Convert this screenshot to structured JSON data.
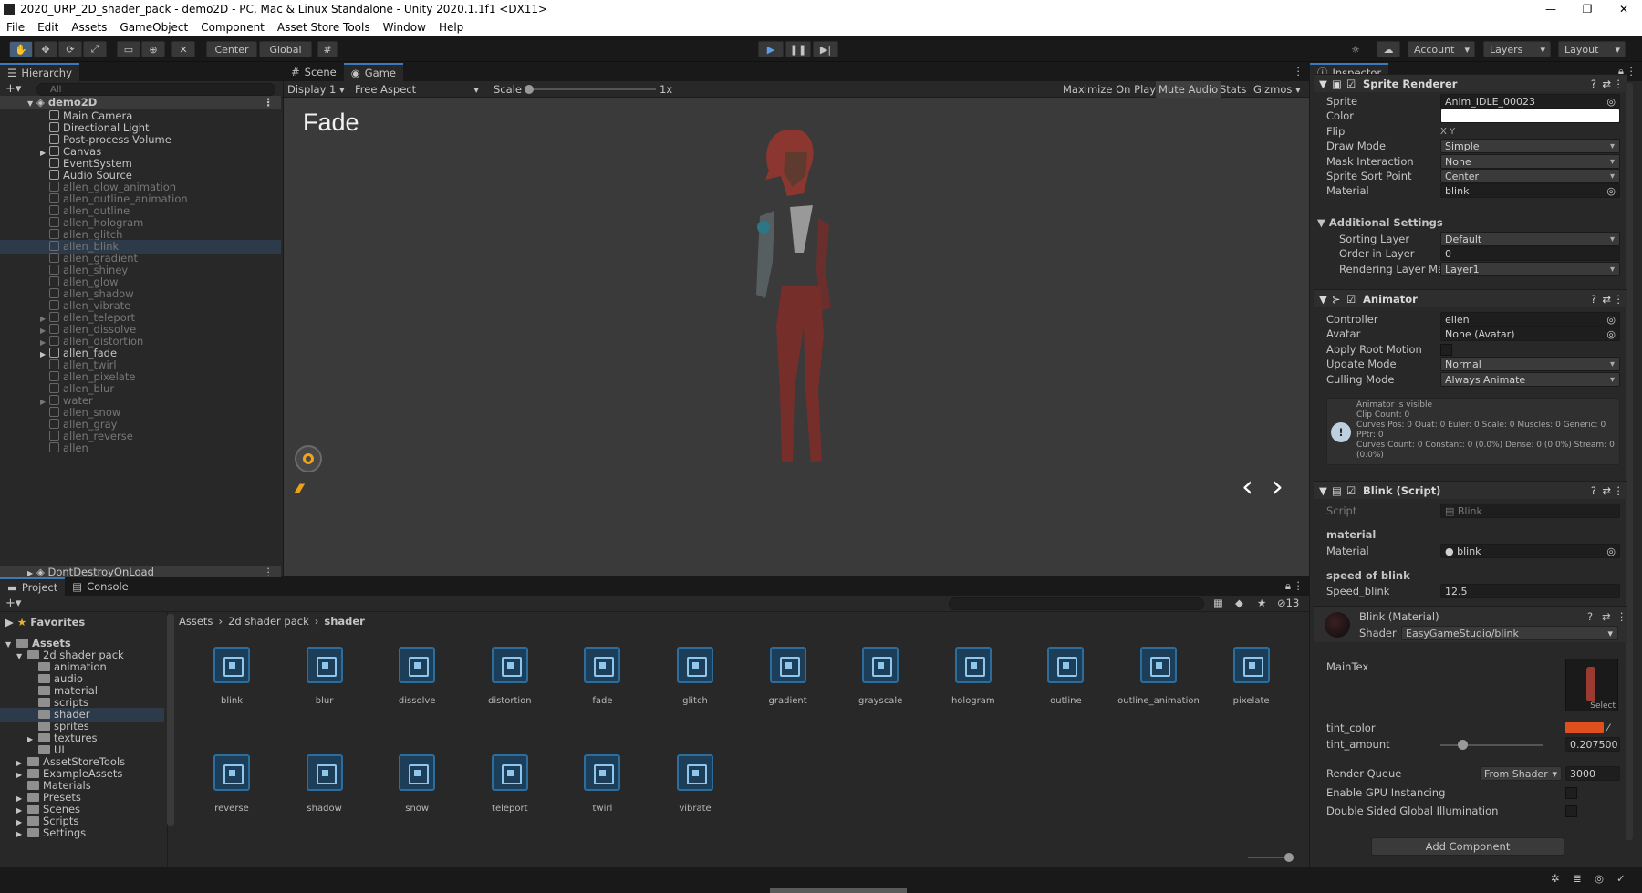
{
  "window": {
    "title": "2020_URP_2D_shader_pack - demo2D - PC, Mac & Linux Standalone - Unity 2020.1.1f1 <DX11>",
    "minimize": "—",
    "maximize": "❐",
    "close": "✕"
  },
  "menu": [
    "File",
    "Edit",
    "Assets",
    "GameObject",
    "Component",
    "Asset Store Tools",
    "Window",
    "Help"
  ],
  "toolbar": {
    "pivot": "Center",
    "space": "Global",
    "account": "Account",
    "layers": "Layers",
    "layout": "Layout"
  },
  "hierarchy": {
    "tab": "Hierarchy",
    "search_placeholder": "All",
    "scene": "demo2D",
    "items": [
      {
        "label": "Main Camera",
        "dim": false,
        "arrow": false
      },
      {
        "label": "Directional Light",
        "dim": false,
        "arrow": false
      },
      {
        "label": "Post-process Volume",
        "dim": false,
        "arrow": false
      },
      {
        "label": "Canvas",
        "dim": false,
        "arrow": true
      },
      {
        "label": "EventSystem",
        "dim": false,
        "arrow": false
      },
      {
        "label": "Audio Source",
        "dim": false,
        "arrow": false
      },
      {
        "label": "allen_glow_animation",
        "dim": true,
        "arrow": false
      },
      {
        "label": "allen_outline_animation",
        "dim": true,
        "arrow": false
      },
      {
        "label": "allen_outline",
        "dim": true,
        "arrow": false
      },
      {
        "label": "allen_hologram",
        "dim": true,
        "arrow": false
      },
      {
        "label": "allen_glitch",
        "dim": true,
        "arrow": false
      },
      {
        "label": "allen_blink",
        "dim": true,
        "arrow": false
      },
      {
        "label": "allen_gradient",
        "dim": true,
        "arrow": false
      },
      {
        "label": "allen_shiney",
        "dim": true,
        "arrow": false
      },
      {
        "label": "allen_glow",
        "dim": true,
        "arrow": false
      },
      {
        "label": "allen_shadow",
        "dim": true,
        "arrow": false
      },
      {
        "label": "allen_vibrate",
        "dim": true,
        "arrow": false
      },
      {
        "label": "allen_teleport",
        "dim": true,
        "arrow": true
      },
      {
        "label": "allen_dissolve",
        "dim": true,
        "arrow": true
      },
      {
        "label": "allen_distortion",
        "dim": true,
        "arrow": true
      },
      {
        "label": "allen_fade",
        "dim": false,
        "arrow": true
      },
      {
        "label": "allen_twirl",
        "dim": true,
        "arrow": false
      },
      {
        "label": "allen_pixelate",
        "dim": true,
        "arrow": false
      },
      {
        "label": "allen_blur",
        "dim": true,
        "arrow": false
      },
      {
        "label": "water",
        "dim": true,
        "arrow": true
      },
      {
        "label": "allen_snow",
        "dim": true,
        "arrow": false
      },
      {
        "label": "allen_gray",
        "dim": true,
        "arrow": false
      },
      {
        "label": "allen_reverse",
        "dim": true,
        "arrow": false
      },
      {
        "label": "allen",
        "dim": true,
        "arrow": false
      }
    ],
    "dontdestroy": "DontDestroyOnLoad"
  },
  "game": {
    "tab_scene": "Scene",
    "tab_game": "Game",
    "display": "Display 1",
    "aspect": "Free Aspect",
    "scale_label": "Scale",
    "scale_value": "1x",
    "maximize": "Maximize On Play",
    "mute": "Mute Audio",
    "stats": "Stats",
    "gizmos": "Gizmos",
    "overlay_title": "Fade",
    "prev": "‹",
    "next": "›"
  },
  "inspector": {
    "tab": "Inspector",
    "sprite_renderer": {
      "title": "Sprite Renderer",
      "rows": [
        {
          "label": "Sprite",
          "value": "Anim_IDLE_00023"
        },
        {
          "label": "Color",
          "value": ""
        },
        {
          "label": "Flip",
          "value": "X      Y"
        },
        {
          "label": "Draw Mode",
          "value": "Simple"
        },
        {
          "label": "Mask Interaction",
          "value": "None"
        },
        {
          "label": "Sprite Sort Point",
          "value": "Center"
        },
        {
          "label": "Material",
          "value": "blink"
        }
      ],
      "additional": "Additional Settings",
      "sub_rows": [
        {
          "label": "Sorting Layer",
          "value": "Default"
        },
        {
          "label": "Order in Layer",
          "value": "0"
        },
        {
          "label": "Rendering Layer Mas",
          "value": "Layer1"
        }
      ]
    },
    "animator": {
      "title": "Animator",
      "rows": [
        {
          "label": "Controller",
          "value": "ellen"
        },
        {
          "label": "Avatar",
          "value": "None (Avatar)"
        },
        {
          "label": "Apply Root Motion",
          "value": ""
        },
        {
          "label": "Update Mode",
          "value": "Normal"
        },
        {
          "label": "Culling Mode",
          "value": "Always Animate"
        }
      ],
      "info": [
        "Animator is visible",
        "Clip Count: 0",
        "Curves Pos: 0 Quat: 0 Euler: 0 Scale: 0 Muscles: 0 Generic: 0",
        "PPtr: 0",
        "Curves Count: 0 Constant: 0 (0.0%) Dense: 0 (0.0%) Stream: 0",
        "(0.0%)"
      ]
    },
    "blink_script": {
      "title": "Blink (Script)",
      "script_label": "Script",
      "script_value": "Blink",
      "header_material": "material",
      "material_label": "Material",
      "material_value": "blink",
      "header_speed": "speed of blink",
      "speed_label": "Speed_blink",
      "speed_value": "12.5"
    },
    "material": {
      "title": "Blink (Material)",
      "shader_label": "Shader",
      "shader_value": "EasyGameStudio/blink",
      "maintex": "MainTex",
      "select": "Select",
      "tint_color": "tint_color",
      "tint_amount": "tint_amount",
      "tint_amount_value": "0.207500",
      "tint_amount_fraction": 0.21,
      "render_queue": "Render Queue",
      "render_queue_mode": "From Shader",
      "render_queue_value": "3000",
      "gpu_instancing": "Enable GPU Instancing",
      "double_sided": "Double Sided Global Illumination",
      "tint_swatch": "#e0501e"
    },
    "add_component": "Add Component"
  },
  "project": {
    "tab_project": "Project",
    "tab_console": "Console",
    "count": "13",
    "favorites": "Favorites",
    "breadcrumb": [
      "Assets",
      "2d shader pack",
      "shader"
    ],
    "tree": [
      {
        "label": "Assets",
        "indent": 0,
        "bold": true
      },
      {
        "label": "2d shader pack",
        "indent": 1,
        "bold": false
      },
      {
        "label": "animation",
        "indent": 2,
        "bold": false
      },
      {
        "label": "audio",
        "indent": 2,
        "bold": false
      },
      {
        "label": "material",
        "indent": 2,
        "bold": false
      },
      {
        "label": "scripts",
        "indent": 2,
        "bold": false
      },
      {
        "label": "shader",
        "indent": 2,
        "bold": false
      },
      {
        "label": "sprites",
        "indent": 2,
        "bold": false
      },
      {
        "label": "textures",
        "indent": 2,
        "bold": false
      },
      {
        "label": "UI",
        "indent": 2,
        "bold": false
      },
      {
        "label": "AssetStoreTools",
        "indent": 1,
        "bold": false
      },
      {
        "label": "ExampleAssets",
        "indent": 1,
        "bold": false
      },
      {
        "label": "Materials",
        "indent": 1,
        "bold": false
      },
      {
        "label": "Presets",
        "indent": 1,
        "bold": false
      },
      {
        "label": "Scenes",
        "indent": 1,
        "bold": false
      },
      {
        "label": "Scripts",
        "indent": 1,
        "bold": false
      },
      {
        "label": "Settings",
        "indent": 1,
        "bold": false
      }
    ],
    "assets": [
      "blink",
      "blur",
      "dissolve",
      "distortion",
      "fade",
      "glitch",
      "gradient",
      "grayscale",
      "hologram",
      "outline",
      "outline_animation",
      "pixelate",
      "reverse",
      "shadow",
      "snow",
      "teleport",
      "twirl",
      "vibrate"
    ]
  }
}
